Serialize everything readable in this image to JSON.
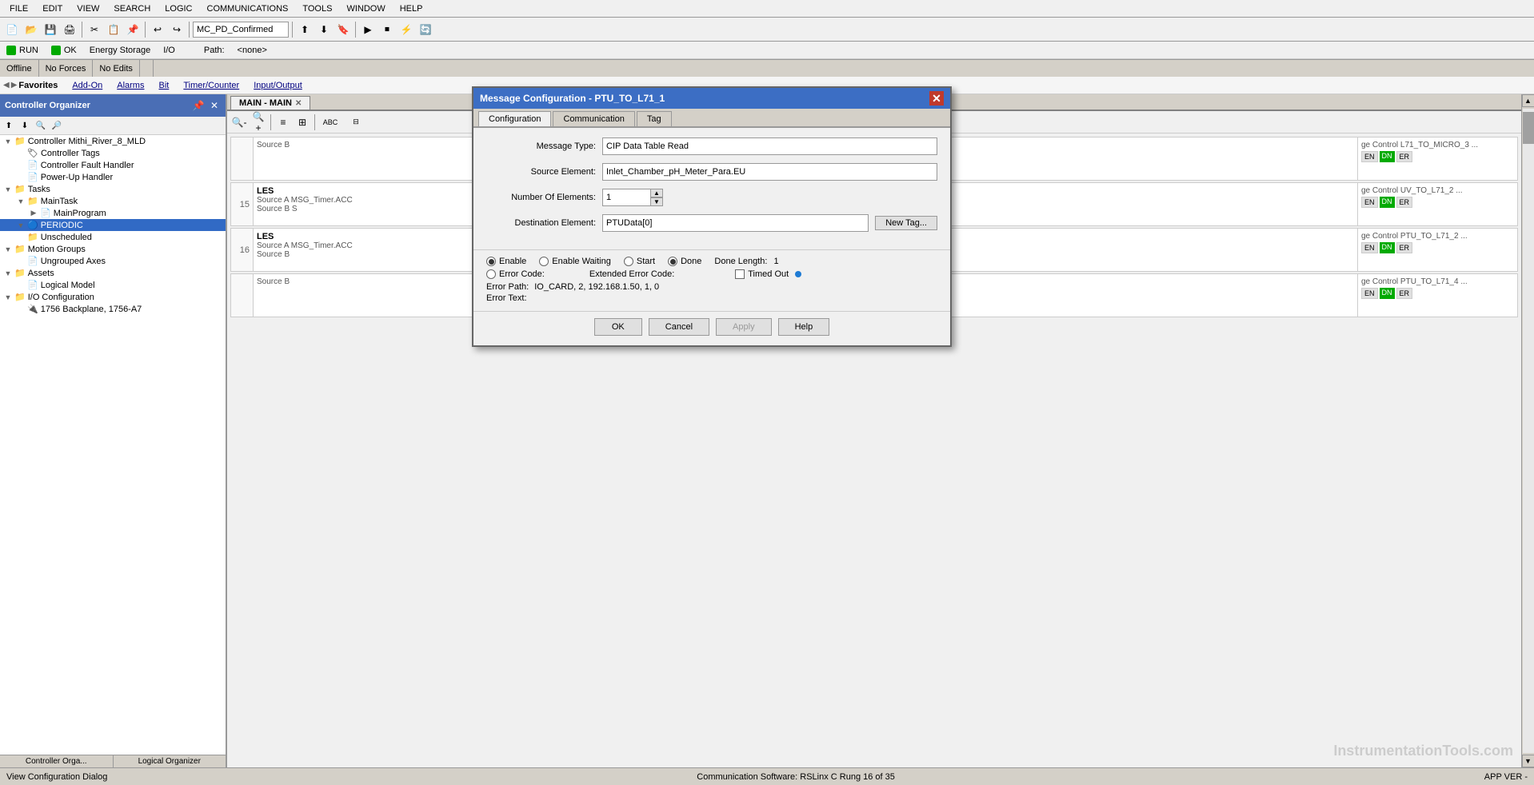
{
  "app": {
    "title": "InstrumentationTools.com"
  },
  "menu": {
    "items": [
      "FILE",
      "EDIT",
      "VIEW",
      "SEARCH",
      "LOGIC",
      "COMMUNICATIONS",
      "TOOLS",
      "WINDOW",
      "HELP"
    ]
  },
  "toolbar": {
    "dropdown_value": "MC_PD_Confirmed"
  },
  "status_top": {
    "run_label": "RUN",
    "ok_label": "OK",
    "energy_label": "Energy Storage",
    "io_label": "I/O",
    "mode_offline": "Offline",
    "forces_label": "No Forces",
    "edits_label": "No Edits",
    "path_label": "Path:",
    "path_value": "<none>"
  },
  "favorites_bar": {
    "label": "Favorites",
    "items": [
      "Add-On",
      "Alarms",
      "Bit",
      "Timer/Counter",
      "Input/Output"
    ]
  },
  "left_panel": {
    "title": "Controller Organizer",
    "tree": [
      {
        "label": "Controller Mithi_River_8_MLD",
        "level": 0,
        "icon": "📁",
        "expanded": true
      },
      {
        "label": "Controller Tags",
        "level": 1,
        "icon": "🏷",
        "expanded": false
      },
      {
        "label": "Controller Fault Handler",
        "level": 1,
        "icon": "📄",
        "expanded": false
      },
      {
        "label": "Power-Up Handler",
        "level": 1,
        "icon": "📄",
        "expanded": false
      },
      {
        "label": "Tasks",
        "level": 0,
        "icon": "📁",
        "expanded": true
      },
      {
        "label": "MainTask",
        "level": 1,
        "icon": "📁",
        "expanded": true
      },
      {
        "label": "MainProgram",
        "level": 2,
        "icon": "📄",
        "expanded": false
      },
      {
        "label": "PERIODIC",
        "level": 1,
        "icon": "📁",
        "expanded": false,
        "selected": true
      },
      {
        "label": "Unscheduled",
        "level": 1,
        "icon": "📁",
        "expanded": false
      },
      {
        "label": "Motion Groups",
        "level": 0,
        "icon": "📁",
        "expanded": true
      },
      {
        "label": "Ungrouped Axes",
        "level": 1,
        "icon": "📄",
        "expanded": false
      },
      {
        "label": "Assets",
        "level": 0,
        "icon": "📁",
        "expanded": true
      },
      {
        "label": "Logical Model",
        "level": 1,
        "icon": "📄",
        "expanded": false
      },
      {
        "label": "I/O Configuration",
        "level": 0,
        "icon": "📁",
        "expanded": true
      },
      {
        "label": "1756 Backplane, 1756-A7",
        "level": 1,
        "icon": "📄",
        "expanded": false
      }
    ]
  },
  "main_tab": {
    "label": "MAIN - MAIN"
  },
  "ladder": {
    "rungs": [
      {
        "number": "",
        "source_b_label": "Source B",
        "source_b_value": "",
        "right_label": "ge Control  L71_TO_MICRO_3  ...",
        "indicators": [
          "EN",
          "DN",
          "ER"
        ]
      },
      {
        "number": "15",
        "label": "LES",
        "source_a_label": "Source A",
        "source_a_value": "MSG_Timer.ACC",
        "source_b_label": "Source B",
        "source_b_value": "S",
        "right_label": "ge Control  UV_TO_L71_2  ...",
        "indicators": [
          "EN",
          "DN",
          "ER"
        ]
      },
      {
        "number": "16",
        "label": "LES",
        "source_a_label": "Source A",
        "source_a_value": "MSG_Timer.ACC",
        "source_b_label": "Source B",
        "source_b_value": "",
        "right_label": "ge Control  PTU_TO_L71_2  ...",
        "indicators": [
          "EN",
          "DN",
          "ER"
        ]
      },
      {
        "number": "",
        "source_b_label": "Source B",
        "source_b_value": "",
        "right_label": "ge Control  PTU_TO_L71_4  ...",
        "indicators": [
          "EN",
          "DN",
          "ER"
        ]
      }
    ]
  },
  "dialog": {
    "title": "Message Configuration - PTU_TO_L71_1",
    "tabs": [
      "Configuration",
      "Communication",
      "Tag"
    ],
    "active_tab": "Configuration",
    "fields": {
      "message_type_label": "Message Type:",
      "message_type_value": "CIP Data Table Read",
      "source_element_label": "Source Element:",
      "source_element_value": "Inlet_Chamber_pH_Meter_Para.EU",
      "number_of_elements_label": "Number Of Elements:",
      "number_of_elements_value": "1",
      "destination_element_label": "Destination Element:",
      "destination_element_value": "PTUData[0]",
      "new_tag_btn": "New Tag..."
    },
    "status": {
      "enable_label": "Enable",
      "enable_waiting_label": "Enable Waiting",
      "start_label": "Start",
      "done_label": "Done",
      "done_length_label": "Done Length:",
      "done_length_value": "1",
      "error_code_label": "Error Code:",
      "extended_error_code_label": "Extended Error Code:",
      "error_path_label": "Error Path:",
      "error_path_value": "IO_CARD, 2, 192.168.1.50, 1, 0",
      "error_text_label": "Error Text:",
      "timed_out_label": "Timed Out"
    },
    "buttons": {
      "ok": "OK",
      "cancel": "Cancel",
      "apply": "Apply",
      "help": "Help"
    }
  },
  "status_bar_mode": {
    "offline": "Offline",
    "no_forces": "No Forces",
    "no_edits": "No Edits"
  },
  "status_bottom": {
    "left_text": "View Configuration Dialog",
    "right_text": "Communication Software: RSLinx C  Rung 16 of 35",
    "app_text": "APP",
    "ver_text": "VER -"
  }
}
